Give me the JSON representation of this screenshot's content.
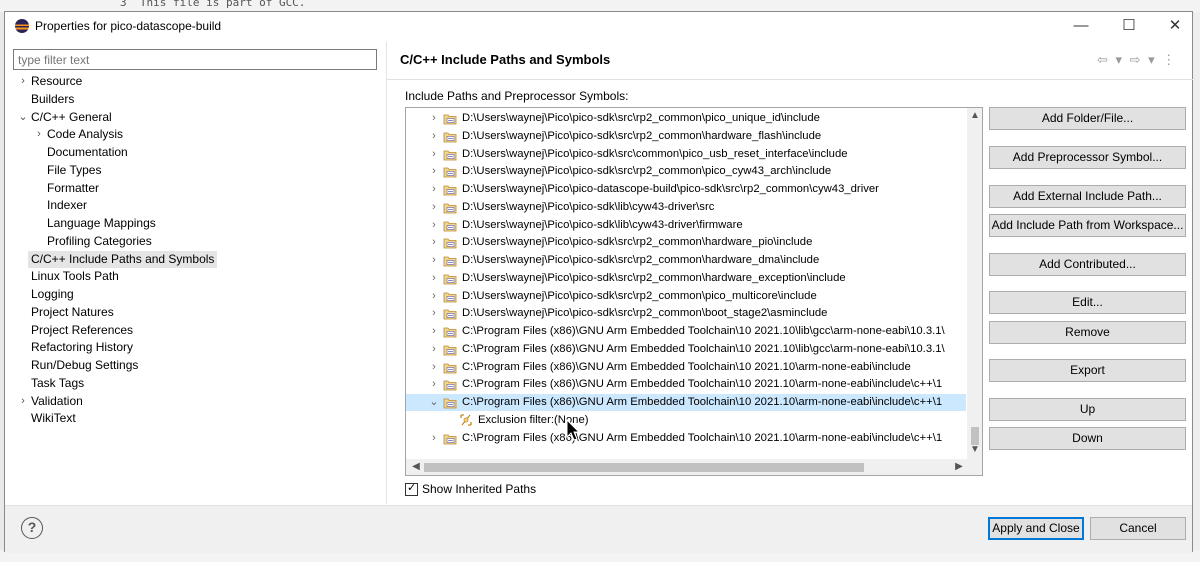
{
  "background": {
    "code_line": "3  This file is part of GCC."
  },
  "dialog": {
    "title": "Properties for pico-datascope-build",
    "window_controls": {
      "minimize": "—",
      "maximize": "☐",
      "close": "✕"
    }
  },
  "filter": {
    "placeholder": "type filter text",
    "value": ""
  },
  "nav": {
    "items": [
      {
        "label": "Resource",
        "level": 0,
        "expander": "collapsed"
      },
      {
        "label": "Builders",
        "level": 0,
        "expander": "none"
      },
      {
        "label": "C/C++ General",
        "level": 0,
        "expander": "expanded"
      },
      {
        "label": "Code Analysis",
        "level": 1,
        "expander": "collapsed"
      },
      {
        "label": "Documentation",
        "level": 1,
        "expander": "none"
      },
      {
        "label": "File Types",
        "level": 1,
        "expander": "none"
      },
      {
        "label": "Formatter",
        "level": 1,
        "expander": "none"
      },
      {
        "label": "Indexer",
        "level": 1,
        "expander": "none"
      },
      {
        "label": "Language Mappings",
        "level": 1,
        "expander": "none"
      },
      {
        "label": "Profiling Categories",
        "level": 1,
        "expander": "none"
      },
      {
        "label": "C/C++ Include Paths and Symbols",
        "level": 0,
        "expander": "none",
        "selected": true
      },
      {
        "label": "Linux Tools Path",
        "level": 0,
        "expander": "none"
      },
      {
        "label": "Logging",
        "level": 0,
        "expander": "none"
      },
      {
        "label": "Project Natures",
        "level": 0,
        "expander": "none"
      },
      {
        "label": "Project References",
        "level": 0,
        "expander": "none"
      },
      {
        "label": "Refactoring History",
        "level": 0,
        "expander": "none"
      },
      {
        "label": "Run/Debug Settings",
        "level": 0,
        "expander": "none"
      },
      {
        "label": "Task Tags",
        "level": 0,
        "expander": "none"
      },
      {
        "label": "Validation",
        "level": 0,
        "expander": "collapsed"
      },
      {
        "label": "WikiText",
        "level": 0,
        "expander": "none"
      }
    ]
  },
  "page": {
    "title": "C/C++ Include Paths and Symbols",
    "header_icons": "⇦ ▾ ⇨ ▾ ⋮",
    "section_label": "Include Paths and Preprocessor Symbols:",
    "paths": [
      {
        "text": "D:\\Users\\waynej\\Pico\\pico-sdk\\src\\rp2_common\\pico_unique_id\\include"
      },
      {
        "text": "D:\\Users\\waynej\\Pico\\pico-sdk\\src\\rp2_common\\hardware_flash\\include"
      },
      {
        "text": "D:\\Users\\waynej\\Pico\\pico-sdk\\src\\common\\pico_usb_reset_interface\\include"
      },
      {
        "text": "D:\\Users\\waynej\\Pico\\pico-sdk\\src\\rp2_common\\pico_cyw43_arch\\include"
      },
      {
        "text": "D:\\Users\\waynej\\Pico\\pico-datascope-build\\pico-sdk\\src\\rp2_common\\cyw43_driver"
      },
      {
        "text": "D:\\Users\\waynej\\Pico\\pico-sdk\\lib\\cyw43-driver\\src"
      },
      {
        "text": "D:\\Users\\waynej\\Pico\\pico-sdk\\lib\\cyw43-driver\\firmware"
      },
      {
        "text": "D:\\Users\\waynej\\Pico\\pico-sdk\\src\\rp2_common\\hardware_pio\\include"
      },
      {
        "text": "D:\\Users\\waynej\\Pico\\pico-sdk\\src\\rp2_common\\hardware_dma\\include"
      },
      {
        "text": "D:\\Users\\waynej\\Pico\\pico-sdk\\src\\rp2_common\\hardware_exception\\include"
      },
      {
        "text": "D:\\Users\\waynej\\Pico\\pico-sdk\\src\\rp2_common\\pico_multicore\\include"
      },
      {
        "text": "D:\\Users\\waynej\\Pico\\pico-sdk\\src\\rp2_common\\boot_stage2\\asminclude"
      },
      {
        "text": "C:\\Program Files (x86)\\GNU Arm Embedded Toolchain\\10 2021.10\\lib\\gcc\\arm-none-eabi\\10.3.1\\"
      },
      {
        "text": "C:\\Program Files (x86)\\GNU Arm Embedded Toolchain\\10 2021.10\\lib\\gcc\\arm-none-eabi\\10.3.1\\"
      },
      {
        "text": "C:\\Program Files (x86)\\GNU Arm Embedded Toolchain\\10 2021.10\\arm-none-eabi\\include"
      },
      {
        "text": "C:\\Program Files (x86)\\GNU Arm Embedded Toolchain\\10 2021.10\\arm-none-eabi\\include\\c++\\1"
      },
      {
        "text": "C:\\Program Files (x86)\\GNU Arm Embedded Toolchain\\10 2021.10\\arm-none-eabi\\include\\c++\\1",
        "expanded": true,
        "selected": true
      },
      {
        "text": "C:\\Program Files (x86)\\GNU Arm Embedded Toolchain\\10 2021.10\\arm-none-eabi\\include\\c++\\1"
      }
    ],
    "exclusion_filter": "Exclusion filter:(None)",
    "buttons": {
      "add_folder_file": "Add Folder/File...",
      "add_preprocessor_symbol": "Add Preprocessor Symbol...",
      "add_external_include_path": "Add External Include Path...",
      "add_include_path_workspace": "Add Include Path from Workspace...",
      "add_contributed": "Add Contributed...",
      "edit": "Edit...",
      "remove": "Remove",
      "export": "Export",
      "up": "Up",
      "down": "Down"
    },
    "show_inherited_paths": {
      "label": "Show Inherited Paths",
      "checked": true
    }
  },
  "footer": {
    "help": "?",
    "apply_and_close": "Apply and Close",
    "cancel": "Cancel"
  },
  "colors": {
    "selection_tree": "#cce8ff",
    "selection_nav": "#e5e5e5",
    "button_face": "#e1e1e1",
    "primary_border": "#0078d7",
    "footer_bg": "#f0f0f0"
  }
}
